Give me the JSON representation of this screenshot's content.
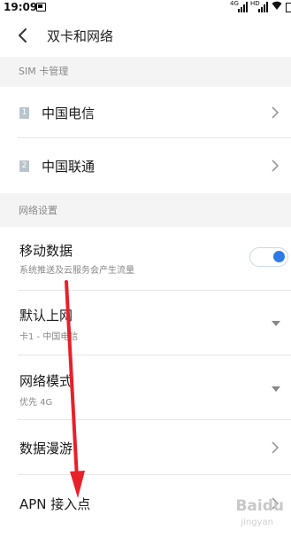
{
  "status_bar": {
    "time": "19:09",
    "signal_labels": [
      "4G",
      "HD"
    ],
    "battery_partial": "6"
  },
  "header": {
    "title": "双卡和网络",
    "back_icon": "chevron-left-icon"
  },
  "sim_section": {
    "header": "SIM 卡管理",
    "items": [
      {
        "badge": "1",
        "label": "中国电信"
      },
      {
        "badge": "2",
        "label": "中国联通"
      }
    ]
  },
  "network_section": {
    "header": "网络设置",
    "mobile_data": {
      "label": "移动数据",
      "sub": "系统推送及云服务会产生流量",
      "enabled": true
    },
    "default_internet": {
      "label": "默认上网",
      "value": "卡1 - 中国电信"
    },
    "network_mode": {
      "label": "网络模式",
      "value": "优先 4G"
    },
    "roaming": {
      "label": "数据漫游"
    },
    "apn": {
      "label": "APN 接入点"
    }
  },
  "colors": {
    "accent": "#2c7be5",
    "annotation_arrow": "#e8202a",
    "section_bg": "#f4f4f4"
  },
  "watermark": {
    "brand": "Baidu",
    "sub": "jingyan"
  }
}
